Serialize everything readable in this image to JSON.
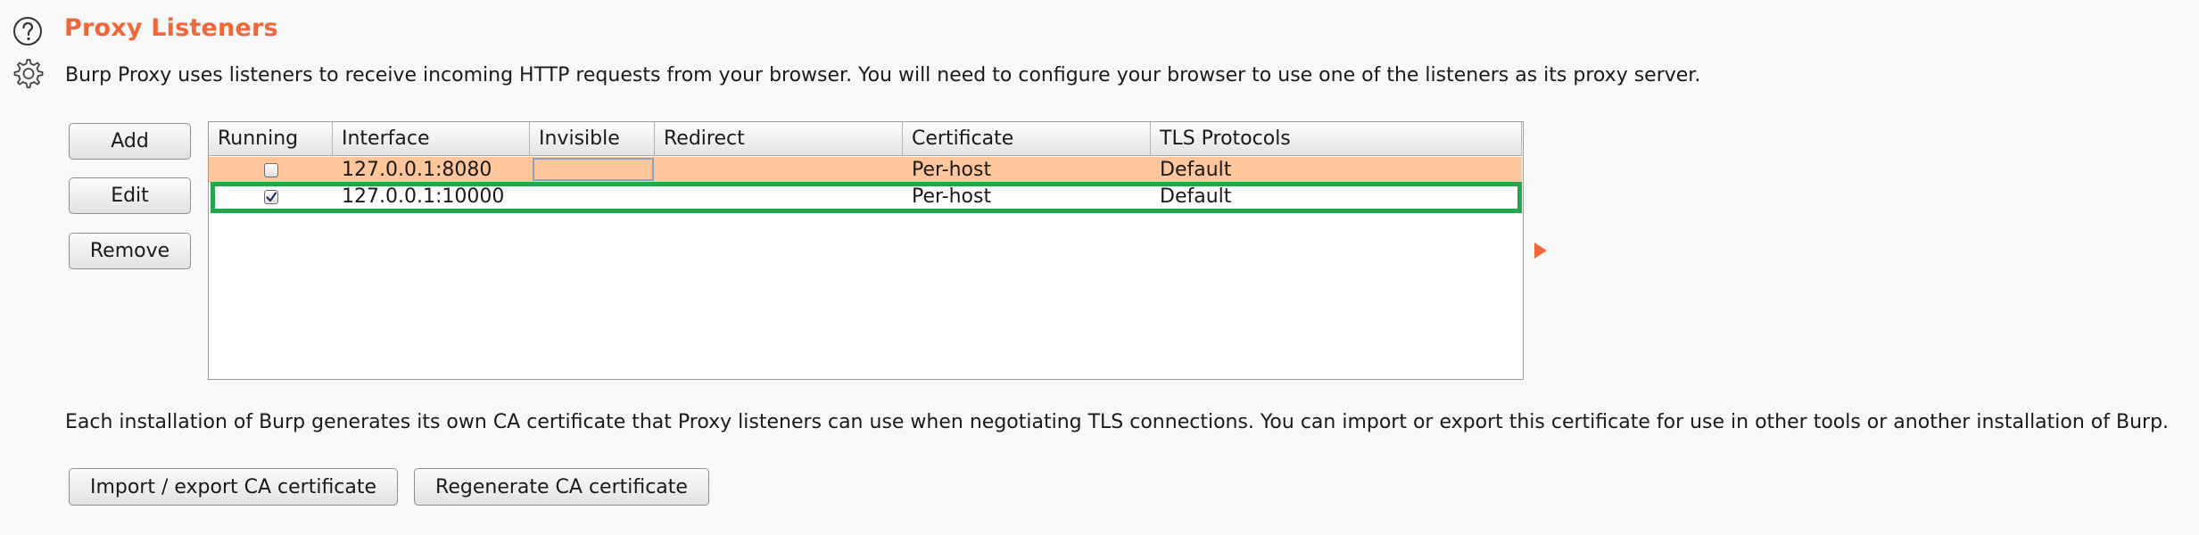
{
  "header": {
    "title": "Proxy Listeners",
    "description": "Burp Proxy uses listeners to receive incoming HTTP requests from your browser. You will need to configure your browser to use one of the listeners as its proxy server."
  },
  "side_buttons": {
    "add": "Add",
    "edit": "Edit",
    "remove": "Remove"
  },
  "table": {
    "columns": [
      "Running",
      "Interface",
      "Invisible",
      "Redirect",
      "Certificate",
      "TLS Protocols"
    ],
    "rows": [
      {
        "running": false,
        "interface": "127.0.0.1:8080",
        "invisible": "",
        "redirect": "",
        "certificate": "Per-host",
        "tls": "Default",
        "selected": true
      },
      {
        "running": true,
        "interface": "127.0.0.1:10000",
        "invisible": "",
        "redirect": "",
        "certificate": "Per-host",
        "tls": "Default",
        "highlighted": true
      }
    ]
  },
  "ca": {
    "description": "Each installation of Burp generates its own CA certificate that Proxy listeners can use when negotiating TLS connections. You can import or export this certificate for use in other tools or another installation of Burp.",
    "import_export_label": "Import / export CA certificate",
    "regenerate_label": "Regenerate CA certificate"
  },
  "icons": {
    "help": "help-icon",
    "settings": "gear-icon",
    "expand": "expand-arrow-icon"
  },
  "colors": {
    "accent": "#f0683a",
    "selected_row": "#ffc69b",
    "highlight_border": "#22a84b"
  }
}
